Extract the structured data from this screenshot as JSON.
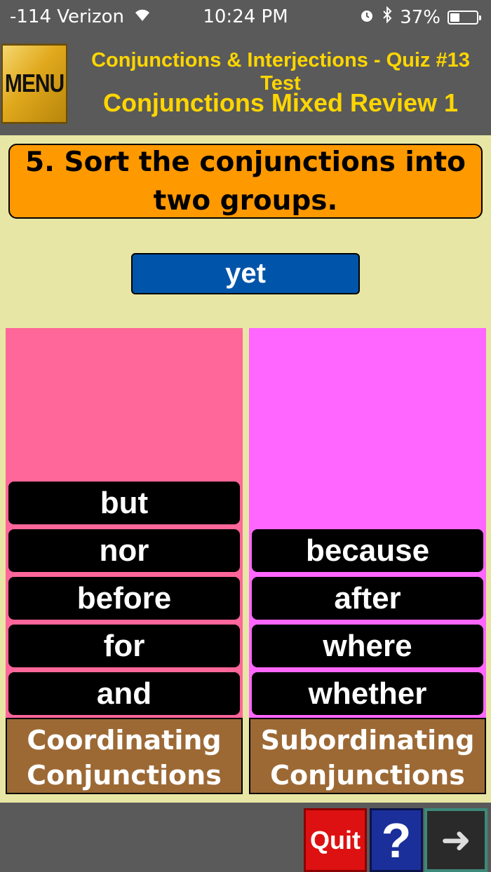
{
  "status_bar": {
    "carrier": "-114 Verizon",
    "time": "10:24 PM",
    "battery_percent": "37%",
    "battery_level": 0.37,
    "icons": [
      "wifi-icon",
      "alarm-icon",
      "bluetooth-icon",
      "battery-icon"
    ]
  },
  "header": {
    "menu_label": "MENU",
    "title": "Conjunctions & Interjections - Quiz #13 Test",
    "subtitle": "Conjunctions Mixed Review 1"
  },
  "question": {
    "text": "5. Sort the conjunctions into two groups."
  },
  "current_word": "yet",
  "columns": [
    {
      "label_line1": "Coordinating",
      "label_line2": "Conjunctions",
      "items": [
        "but",
        "nor",
        "before",
        "for",
        "and"
      ]
    },
    {
      "label_line1": "Subordinating",
      "label_line2": "Conjunctions",
      "items": [
        "because",
        "after",
        "where",
        "whether"
      ]
    }
  ],
  "footer": {
    "quit_label": "Quit",
    "help_label": "?",
    "next_label": "➜"
  },
  "colors": {
    "background": "#e8e6a4",
    "header": "#5a5a5a",
    "title": "#ffd600",
    "question_box": "#ff9900",
    "word_tile": "#0055aa",
    "left_column": "#ff6699",
    "right_column": "#ff66ff",
    "column_label": "#9c6935",
    "quit": "#dd1111",
    "help": "#1a2f9a"
  }
}
